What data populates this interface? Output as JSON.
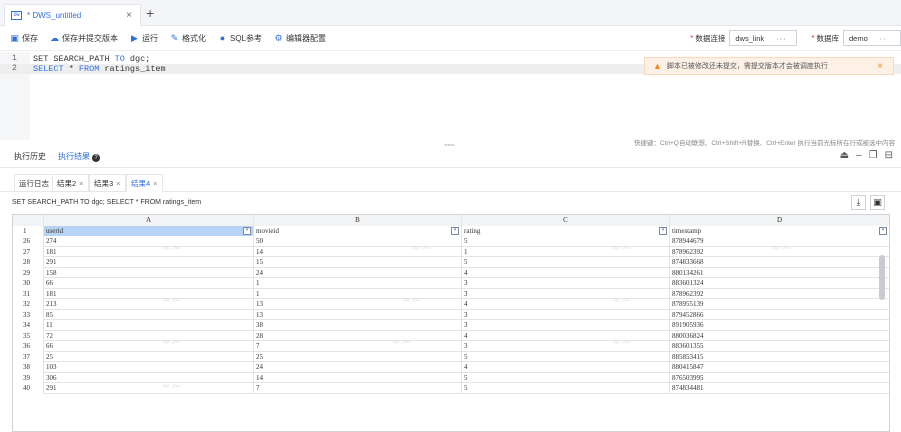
{
  "tab": {
    "icon_label": "DW",
    "name": "* DWS_untitled",
    "close": "×",
    "add": "+"
  },
  "toolbar": {
    "save": "保存",
    "save_submit": "保存并提交版本",
    "run": "运行",
    "format": "格式化",
    "sql_ref": "SQL参考",
    "editor_config": "编辑器配置",
    "conn_label": "数据连接",
    "conn_value": "dws_link",
    "conn_more": "···",
    "db_label": "数据库",
    "db_value": "demo",
    "db_more": "··",
    "required_mark": "*"
  },
  "editor": {
    "lines": [
      {
        "num": "1",
        "kw1": "SET",
        "t1": " SEARCH_PATH ",
        "kw2": "TO",
        "t2": " dgc;"
      },
      {
        "num": "2",
        "kw1": "SELECT",
        "t1": " * ",
        "kw2": "FROM",
        "t2": " ratings_item"
      }
    ]
  },
  "alert": {
    "text": "脚本已被修改还未提交，需提交版本才会被调度执行",
    "close": "×"
  },
  "hint": "快捷键：Ctrl+Q自动联想、Ctrl+Shift+R替换、Ctrl+Enter 执行当前光标所在行或被选中内容",
  "splitter": "===",
  "results": {
    "tab_history": "执行历史",
    "tab_result": "执行结果",
    "help": "?",
    "sub_tabs": [
      {
        "label": "运行日志",
        "close": ""
      },
      {
        "label": "结果2",
        "close": "×"
      },
      {
        "label": "结果3",
        "close": "×"
      },
      {
        "label": "结果4",
        "close": "×"
      }
    ],
    "sql_text": "SET SEARCH_PATH TO dgc; SELECT * FROM ratings_item"
  },
  "grid": {
    "col_letters": [
      "A",
      "B",
      "C",
      "D"
    ],
    "header_row_num": "1",
    "headers": [
      "userid",
      "movieid",
      "rating",
      "timestamp"
    ],
    "filter_icon": "▾",
    "watermark": "dgc_dws",
    "rows": [
      [
        "26",
        "274",
        "50",
        "5",
        "878944679"
      ],
      [
        "27",
        "181",
        "14",
        "1",
        "878962392"
      ],
      [
        "28",
        "291",
        "15",
        "5",
        "874833668"
      ],
      [
        "29",
        "158",
        "24",
        "4",
        "880134261"
      ],
      [
        "30",
        "66",
        "1",
        "3",
        "883601324"
      ],
      [
        "31",
        "181",
        "1",
        "3",
        "878962392"
      ],
      [
        "32",
        "213",
        "13",
        "4",
        "878955139"
      ],
      [
        "33",
        "85",
        "13",
        "3",
        "879452866"
      ],
      [
        "34",
        "11",
        "38",
        "3",
        "891905936"
      ],
      [
        "35",
        "72",
        "28",
        "4",
        "880036824"
      ],
      [
        "36",
        "66",
        "7",
        "3",
        "883601355"
      ],
      [
        "37",
        "25",
        "25",
        "5",
        "885853415"
      ],
      [
        "38",
        "103",
        "24",
        "4",
        "880415847"
      ],
      [
        "39",
        "306",
        "14",
        "5",
        "876503995"
      ],
      [
        "40",
        "291",
        "7",
        "5",
        "874834481"
      ]
    ]
  }
}
